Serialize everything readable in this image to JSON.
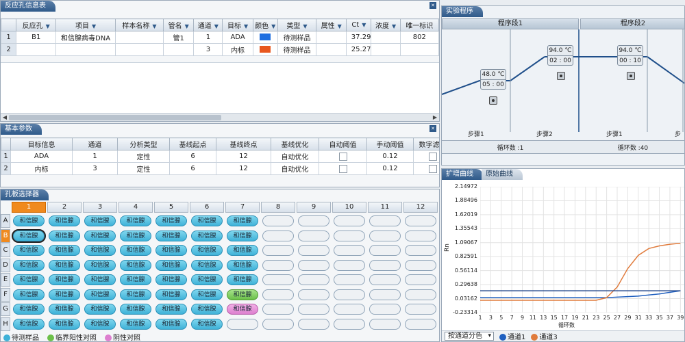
{
  "reaction_info": {
    "tab": "反应孔信息表",
    "headers": [
      "反应孔",
      "项目",
      "样本名称",
      "管名",
      "通道",
      "目标",
      "颜色",
      "类型",
      "属性",
      "Ct",
      "浓度",
      "唯一标识"
    ],
    "rows": [
      {
        "index": "1",
        "well": "B1",
        "project": "和信腺病毒DNA",
        "sample": "",
        "tube": "管1",
        "channel": "1",
        "target": "ADA",
        "color": "#1f6fe0",
        "type": "待测样品",
        "attr": "",
        "ct": "37.29",
        "conc": "",
        "uid": "802"
      },
      {
        "index": "2",
        "well": "",
        "project": "",
        "sample": "",
        "tube": "",
        "channel": "3",
        "target": "内标",
        "color": "#e8571e",
        "type": "待测样品",
        "attr": "",
        "ct": "25.27",
        "conc": "",
        "uid": ""
      }
    ]
  },
  "basic_params": {
    "tab": "基本参数",
    "headers": [
      "目标信息",
      "通道",
      "分析类型",
      "基线起点",
      "基线终点",
      "基线优化",
      "自动阈值",
      "手动阈值",
      "数字滤波"
    ],
    "rows": [
      {
        "index": "1",
        "target": "ADA",
        "channel": "1",
        "analysis": "定性",
        "start": "6",
        "end": "12",
        "opt": "自动优化",
        "manual": "0.12"
      },
      {
        "index": "2",
        "target": "内标",
        "channel": "3",
        "analysis": "定性",
        "start": "6",
        "end": "12",
        "opt": "自动优化",
        "manual": "0.12"
      }
    ]
  },
  "plate": {
    "tab": "孔板选择器",
    "columns": [
      "1",
      "2",
      "3",
      "4",
      "5",
      "6",
      "7",
      "8",
      "9",
      "10",
      "11",
      "12"
    ],
    "rows": [
      "A",
      "B",
      "C",
      "D",
      "E",
      "F",
      "G",
      "H"
    ],
    "well_label": "和信腺",
    "active_column": "1",
    "active_row": "B",
    "legend": [
      "待测样品",
      "临界阳性对照",
      "阴性对照"
    ],
    "legend_colors": [
      "#3fb2d8",
      "#6cc04a",
      "#dd7fcf"
    ]
  },
  "program": {
    "tab": "实验程序",
    "segments": [
      "程序段1",
      "程序段2"
    ],
    "steps": [
      {
        "temp": "48.0 ℃",
        "time": "05 : 00"
      },
      {
        "temp": "94.0 ℃",
        "time": "02 : 00"
      },
      {
        "temp": "94.0 ℃",
        "time": "00 : 10"
      }
    ],
    "step_labels": [
      "步骤1",
      "步骤2",
      "步骤1",
      "步"
    ],
    "cycles": [
      "循环数 :1",
      "循环数 :40"
    ]
  },
  "curve": {
    "tabs": [
      "扩增曲线",
      "原始曲线"
    ],
    "ylabel": "Rn",
    "xlabel": "循环数",
    "channel_select": "按通道分色",
    "legend": [
      "通道1",
      "通道3"
    ],
    "legend_colors": [
      "#1f5fbf",
      "#e07b3c"
    ]
  },
  "chart_data": {
    "type": "line",
    "title": "",
    "xlabel": "循环数",
    "ylabel": "Rn",
    "x": [
      1,
      3,
      5,
      7,
      9,
      11,
      13,
      15,
      17,
      19,
      21,
      23,
      25,
      27,
      29,
      31,
      33,
      35,
      37,
      39
    ],
    "yticks": [
      "2.14972",
      "1.88496",
      "1.62019",
      "1.35543",
      "1.09067",
      "0.82591",
      "0.56114",
      "0.29638",
      "0.03162",
      "-0.23314"
    ],
    "ylim": [
      -0.23314,
      2.14972
    ],
    "series": [
      {
        "name": "通道1",
        "values": [
          0.05,
          0.05,
          0.05,
          0.05,
          0.05,
          0.05,
          0.05,
          0.05,
          0.05,
          0.05,
          0.05,
          0.05,
          0.05,
          0.06,
          0.07,
          0.08,
          0.1,
          0.12,
          0.15,
          0.18
        ]
      },
      {
        "name": "通道3",
        "values": [
          0.0,
          0.0,
          0.0,
          0.0,
          0.0,
          0.0,
          0.0,
          0.0,
          0.0,
          0.0,
          0.0,
          0.0,
          0.05,
          0.25,
          0.6,
          0.85,
          0.98,
          1.03,
          1.06,
          1.08
        ]
      },
      {
        "values": [
          0.18,
          0.18,
          0.18,
          0.18,
          0.18,
          0.18,
          0.18,
          0.18,
          0.18,
          0.18,
          0.18,
          0.18,
          0.18,
          0.18,
          0.18,
          0.18,
          0.18,
          0.18,
          0.18,
          0.18
        ]
      }
    ],
    "xticks": [
      "1",
      "3",
      "5",
      "7",
      "9",
      "11",
      "13",
      "15",
      "17",
      "19",
      "21",
      "23",
      "25",
      "27",
      "29",
      "31",
      "33",
      "35",
      "37",
      "39"
    ]
  }
}
